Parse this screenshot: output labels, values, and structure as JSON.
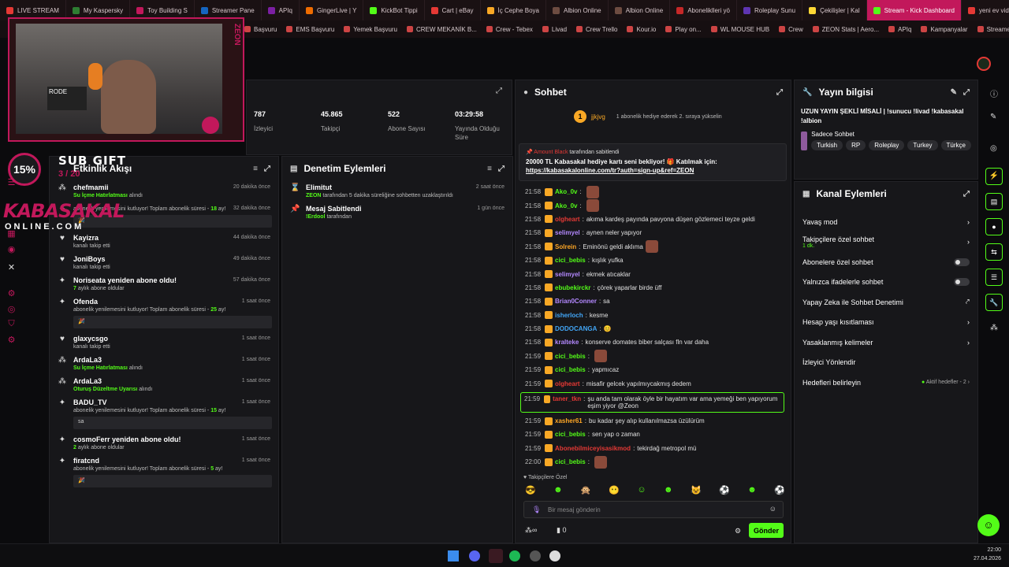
{
  "browser": {
    "tabs": [
      {
        "label": "LIVE STREAM",
        "color": "#e53935"
      },
      {
        "label": "My Kaspersky",
        "color": "#2e7d32"
      },
      {
        "label": "Toy Building S",
        "color": "#c2185b"
      },
      {
        "label": "Streamer Pane",
        "color": "#1565c0"
      },
      {
        "label": "APIq",
        "color": "#7b1fa2"
      },
      {
        "label": "GingerLive | Y",
        "color": "#ef6c00"
      },
      {
        "label": "KickBot Tippi",
        "color": "#53fc18"
      },
      {
        "label": "Cart | eBay",
        "color": "#e53935"
      },
      {
        "label": "İç Cephe Boya",
        "color": "#f9a825"
      },
      {
        "label": "Albion Online",
        "color": "#6d4c41"
      },
      {
        "label": "Albion Online",
        "color": "#6d4c41"
      },
      {
        "label": "Aboneliklleri yö",
        "color": "#c62828"
      },
      {
        "label": "Roleplay Sunu",
        "color": "#5e35b1"
      },
      {
        "label": "Çekilişler | Kal",
        "color": "#fdd835"
      },
      {
        "label": "Stream - Kick Dashboard",
        "color": "#53fc18"
      },
      {
        "label": "yeni ev videok",
        "color": "#e53935"
      }
    ],
    "active_tab": "Stream - Kick Dashboard",
    "bookmarks": [
      "Başvuru",
      "EMS Başvuru",
      "Yemek Başvuru",
      "CREW MEKANİK B...",
      "Crew - Tebex",
      "Livad",
      "Crew Trello",
      "Kour.io",
      "Play on...",
      "WL MOUSE HUB",
      "Crew",
      "ZEON Stats | Aero...",
      "APIq",
      "Kampanyalar",
      "Streamer Panel"
    ]
  },
  "overlay": {
    "sub_gift_label": "SUB GIFT",
    "sub_gift_count": "3 / 20",
    "percent": "15%",
    "brand_line1": "KABASAKAL",
    "brand_line2": "ONLINE.COM",
    "cam_brand": "ZEON",
    "cam_shirt": "RODE"
  },
  "stats": [
    {
      "value": "787",
      "label": "İzleyici"
    },
    {
      "value": "45.865",
      "label": "Takipçi"
    },
    {
      "value": "522",
      "label": "Abone Sayısı"
    },
    {
      "value": "03:29:58",
      "label": "Yayında Olduğu Süre"
    }
  ],
  "activity": {
    "title": "Etkinlik Akışı",
    "items": [
      {
        "icon": "gift-icon",
        "name": "chefmamii",
        "sub": "",
        "sub_green": "Su İçme Hatırlatması",
        "sub_tail": " alındı",
        "time": "20 dakika önce",
        "box": ""
      },
      {
        "icon": "star-icon",
        "name": "",
        "sub": "abonelik yenilemesini kutluyor! Toplam abonelik süresi - ",
        "sub_green": "18",
        "sub_tail": " ay!",
        "time": "32 dakika önce",
        "box": "🎉"
      },
      {
        "icon": "heart-icon",
        "name": "Kayizra",
        "sub": "kanalı takip etti",
        "sub_green": "",
        "sub_tail": "",
        "time": "44 dakika önce",
        "box": ""
      },
      {
        "icon": "heart-icon",
        "name": "JoniBoys",
        "sub": "kanalı takip etti",
        "sub_green": "",
        "sub_tail": "",
        "time": "49 dakika önce",
        "box": ""
      },
      {
        "icon": "star-icon",
        "name": "Noriseata yeniden abone oldu!",
        "sub": "",
        "sub_green": "7",
        "sub_tail": " aylık abone oldular",
        "time": "57 dakika önce",
        "box": ""
      },
      {
        "icon": "star-icon",
        "name": "Ofenda",
        "sub": "abonelik yenilemesini kutluyor! Toplam abonelik süresi - ",
        "sub_green": "25",
        "sub_tail": " ay!",
        "time": "1 saat önce",
        "box": "🎉"
      },
      {
        "icon": "heart-icon",
        "name": "glaxycsgo",
        "sub": "kanalı takip etti",
        "sub_green": "",
        "sub_tail": "",
        "time": "1 saat önce",
        "box": ""
      },
      {
        "icon": "gift-icon",
        "name": "ArdaLa3",
        "sub": "",
        "sub_green": "Su İçme Hatırlatması",
        "sub_tail": " alındı",
        "time": "1 saat önce",
        "box": ""
      },
      {
        "icon": "gift-icon",
        "name": "ArdaLa3",
        "sub": "",
        "sub_green": "Oturuş Düzeltme Uyarısı",
        "sub_tail": " alındı",
        "time": "1 saat önce",
        "box": ""
      },
      {
        "icon": "star-icon",
        "name": "BADU_TV",
        "sub": "abonelik yenilemesini kutluyor! Toplam abonelik süresi - ",
        "sub_green": "15",
        "sub_tail": " ay!",
        "time": "1 saat önce",
        "box": "sa"
      },
      {
        "icon": "star-icon",
        "name": "cosmoFerr yeniden abone oldu!",
        "sub": "",
        "sub_green": "2",
        "sub_tail": " aylık abone oldular",
        "time": "1 saat önce",
        "box": ""
      },
      {
        "icon": "star-icon",
        "name": "firatcnd",
        "sub": "abonelik yenilemesini kutluyor! Toplam abonelik süresi - ",
        "sub_green": "5",
        "sub_tail": " ay!",
        "time": "1 saat önce",
        "box": "🎉"
      }
    ]
  },
  "moderation": {
    "title": "Denetim Eylemleri",
    "items": [
      {
        "icon": "hourglass-icon",
        "name": "Elimitut",
        "actor": "ZEON",
        "detail": " tarafından 5 dakika süreliğine sohbetten uzaklaştırıldı",
        "time": "2 saat önce"
      },
      {
        "icon": "pin-icon",
        "name": "Mesaj Sabitlendi",
        "actor": "!Erdool",
        "detail": " tarafından",
        "time": "1 gün önce"
      }
    ]
  },
  "chat": {
    "title": "Sohbet",
    "top_user": "jjkjvg",
    "top_user_count": "1",
    "top_hint": "1 abonelik hediye ederek 2. sıraya yükselin",
    "pinned_by": "tarafından sabitlendi",
    "pinned_user": "Amount Black",
    "pinned_text": "20000 TL Kabasakal hediye kartı seni bekliyor! 🎁 Katılmak için:",
    "pinned_link": "https://kabasakalonline.com/tr?auth=sign-up&ref=ZEON",
    "messages": [
      {
        "t": "21:58",
        "u": "Ako_0v",
        "c": "#53fc18",
        "m": "",
        "e": true
      },
      {
        "t": "21:58",
        "u": "Ako_0v",
        "c": "#53fc18",
        "m": "",
        "e": true
      },
      {
        "t": "21:58",
        "u": "olgheart",
        "c": "#e53935",
        "m": "akıma kardeş payında pavyona düşen gözlemeci teyze geldi",
        "e": false
      },
      {
        "t": "21:58",
        "u": "selimyel",
        "c": "#b388ff",
        "m": "aynen neler yapıyor",
        "e": false
      },
      {
        "t": "21:58",
        "u": "Solrein",
        "c": "#ffa726",
        "m": "Eminönü geldi aklıma",
        "e": true
      },
      {
        "t": "21:58",
        "u": "cici_bebis",
        "c": "#53fc18",
        "m": "kışlık yufka",
        "e": false
      },
      {
        "t": "21:58",
        "u": "selimyel",
        "c": "#b388ff",
        "m": "ekmek atıcaklar",
        "e": false
      },
      {
        "t": "21:58",
        "u": "ebubekirckr",
        "c": "#53fc18",
        "m": "çörek yaparlar birde üff",
        "e": false
      },
      {
        "t": "21:58",
        "u": "Brian0Conner",
        "c": "#b388ff",
        "m": "sa",
        "e": false
      },
      {
        "t": "21:58",
        "u": "isherloch",
        "c": "#42a5f5",
        "m": "kesme",
        "e": false
      },
      {
        "t": "21:58",
        "u": "DODOCANGA",
        "c": "#42a5f5",
        "m": "😊",
        "e": false
      },
      {
        "t": "21:58",
        "u": "kralteke",
        "c": "#b388ff",
        "m": "konserve domates biber salçası fln var daha",
        "e": false
      },
      {
        "t": "21:59",
        "u": "cici_bebis",
        "c": "#53fc18",
        "m": "",
        "e": true
      },
      {
        "t": "21:59",
        "u": "cici_bebis",
        "c": "#53fc18",
        "m": "yapmıcaz",
        "e": false
      },
      {
        "t": "21:59",
        "u": "olgheart",
        "c": "#e53935",
        "m": "misafir gelcek yapılmıycakmış dedem",
        "e": false
      }
    ],
    "highlight": {
      "t": "21:59",
      "u": "taner_tkn",
      "m": "şu anda tam olarak öyle bir hayatım var ama yemeği ben yapıyorum eşim yiyor @Zeon"
    },
    "messages2": [
      {
        "t": "21:59",
        "u": "xasher61",
        "c": "#ffa726",
        "m": "bu kadar şey alıp kullanılmazsa üzülürüm",
        "e": false
      },
      {
        "t": "21:59",
        "u": "cici_bebis",
        "c": "#53fc18",
        "m": "sen yap o zaman",
        "e": false
      },
      {
        "t": "21:59",
        "u": "Abonebilmiceyisasikmod",
        "c": "#e53935",
        "m": "tekirdağ metropol mü",
        "e": false
      },
      {
        "t": "22:00",
        "u": "cici_bebis",
        "c": "#53fc18",
        "m": "",
        "e": true
      }
    ],
    "mode_label": "Takipçilere Özel",
    "input_placeholder": "Bir mesaj gönderin",
    "count": "0",
    "send_label": "Gönder"
  },
  "stream_info": {
    "title": "Yayın bilgisi",
    "stream_title": "UZUN YAYIN ŞEKLİ MİSALİ | !sunucu !livad !kabasakal !albion",
    "category": "Sadece Sohbet",
    "tags": [
      "Turkish",
      "RP",
      "Roleplay",
      "Turkey",
      "Türkçe"
    ]
  },
  "channel_actions": {
    "title": "Kanal Eylemleri",
    "rows": [
      {
        "label": "Yavaş mod",
        "sub": "",
        "ctrl": "chevron"
      },
      {
        "label": "Takipçilere özel sohbet",
        "sub": "1 dk.",
        "ctrl": "chevron"
      },
      {
        "label": "Abonelere özel sohbet",
        "sub": "",
        "ctrl": "toggle"
      },
      {
        "label": "Yalnızca ifadelerle sohbet",
        "sub": "",
        "ctrl": "toggle"
      },
      {
        "label": "Yapay Zeka ile Sohbet Denetimi",
        "sub": "",
        "ctrl": "external"
      },
      {
        "label": "Hesap yaşı kısıtlaması",
        "sub": "",
        "ctrl": "chevron"
      },
      {
        "label": "Yasaklanmış kelimeler",
        "sub": "",
        "ctrl": "chevron"
      },
      {
        "label": "İzleyici Yönlendir",
        "sub": "",
        "ctrl": "none"
      },
      {
        "label": "Hedefleri belirleyin",
        "sub": "",
        "ctrl": "goal"
      }
    ],
    "goal_status": "Aktif hedefler - 2"
  },
  "taskbar": {
    "time": "22:00",
    "date": "27.04.2026"
  },
  "colors": {
    "accent": "#53fc18",
    "brand": "#c2185b"
  }
}
